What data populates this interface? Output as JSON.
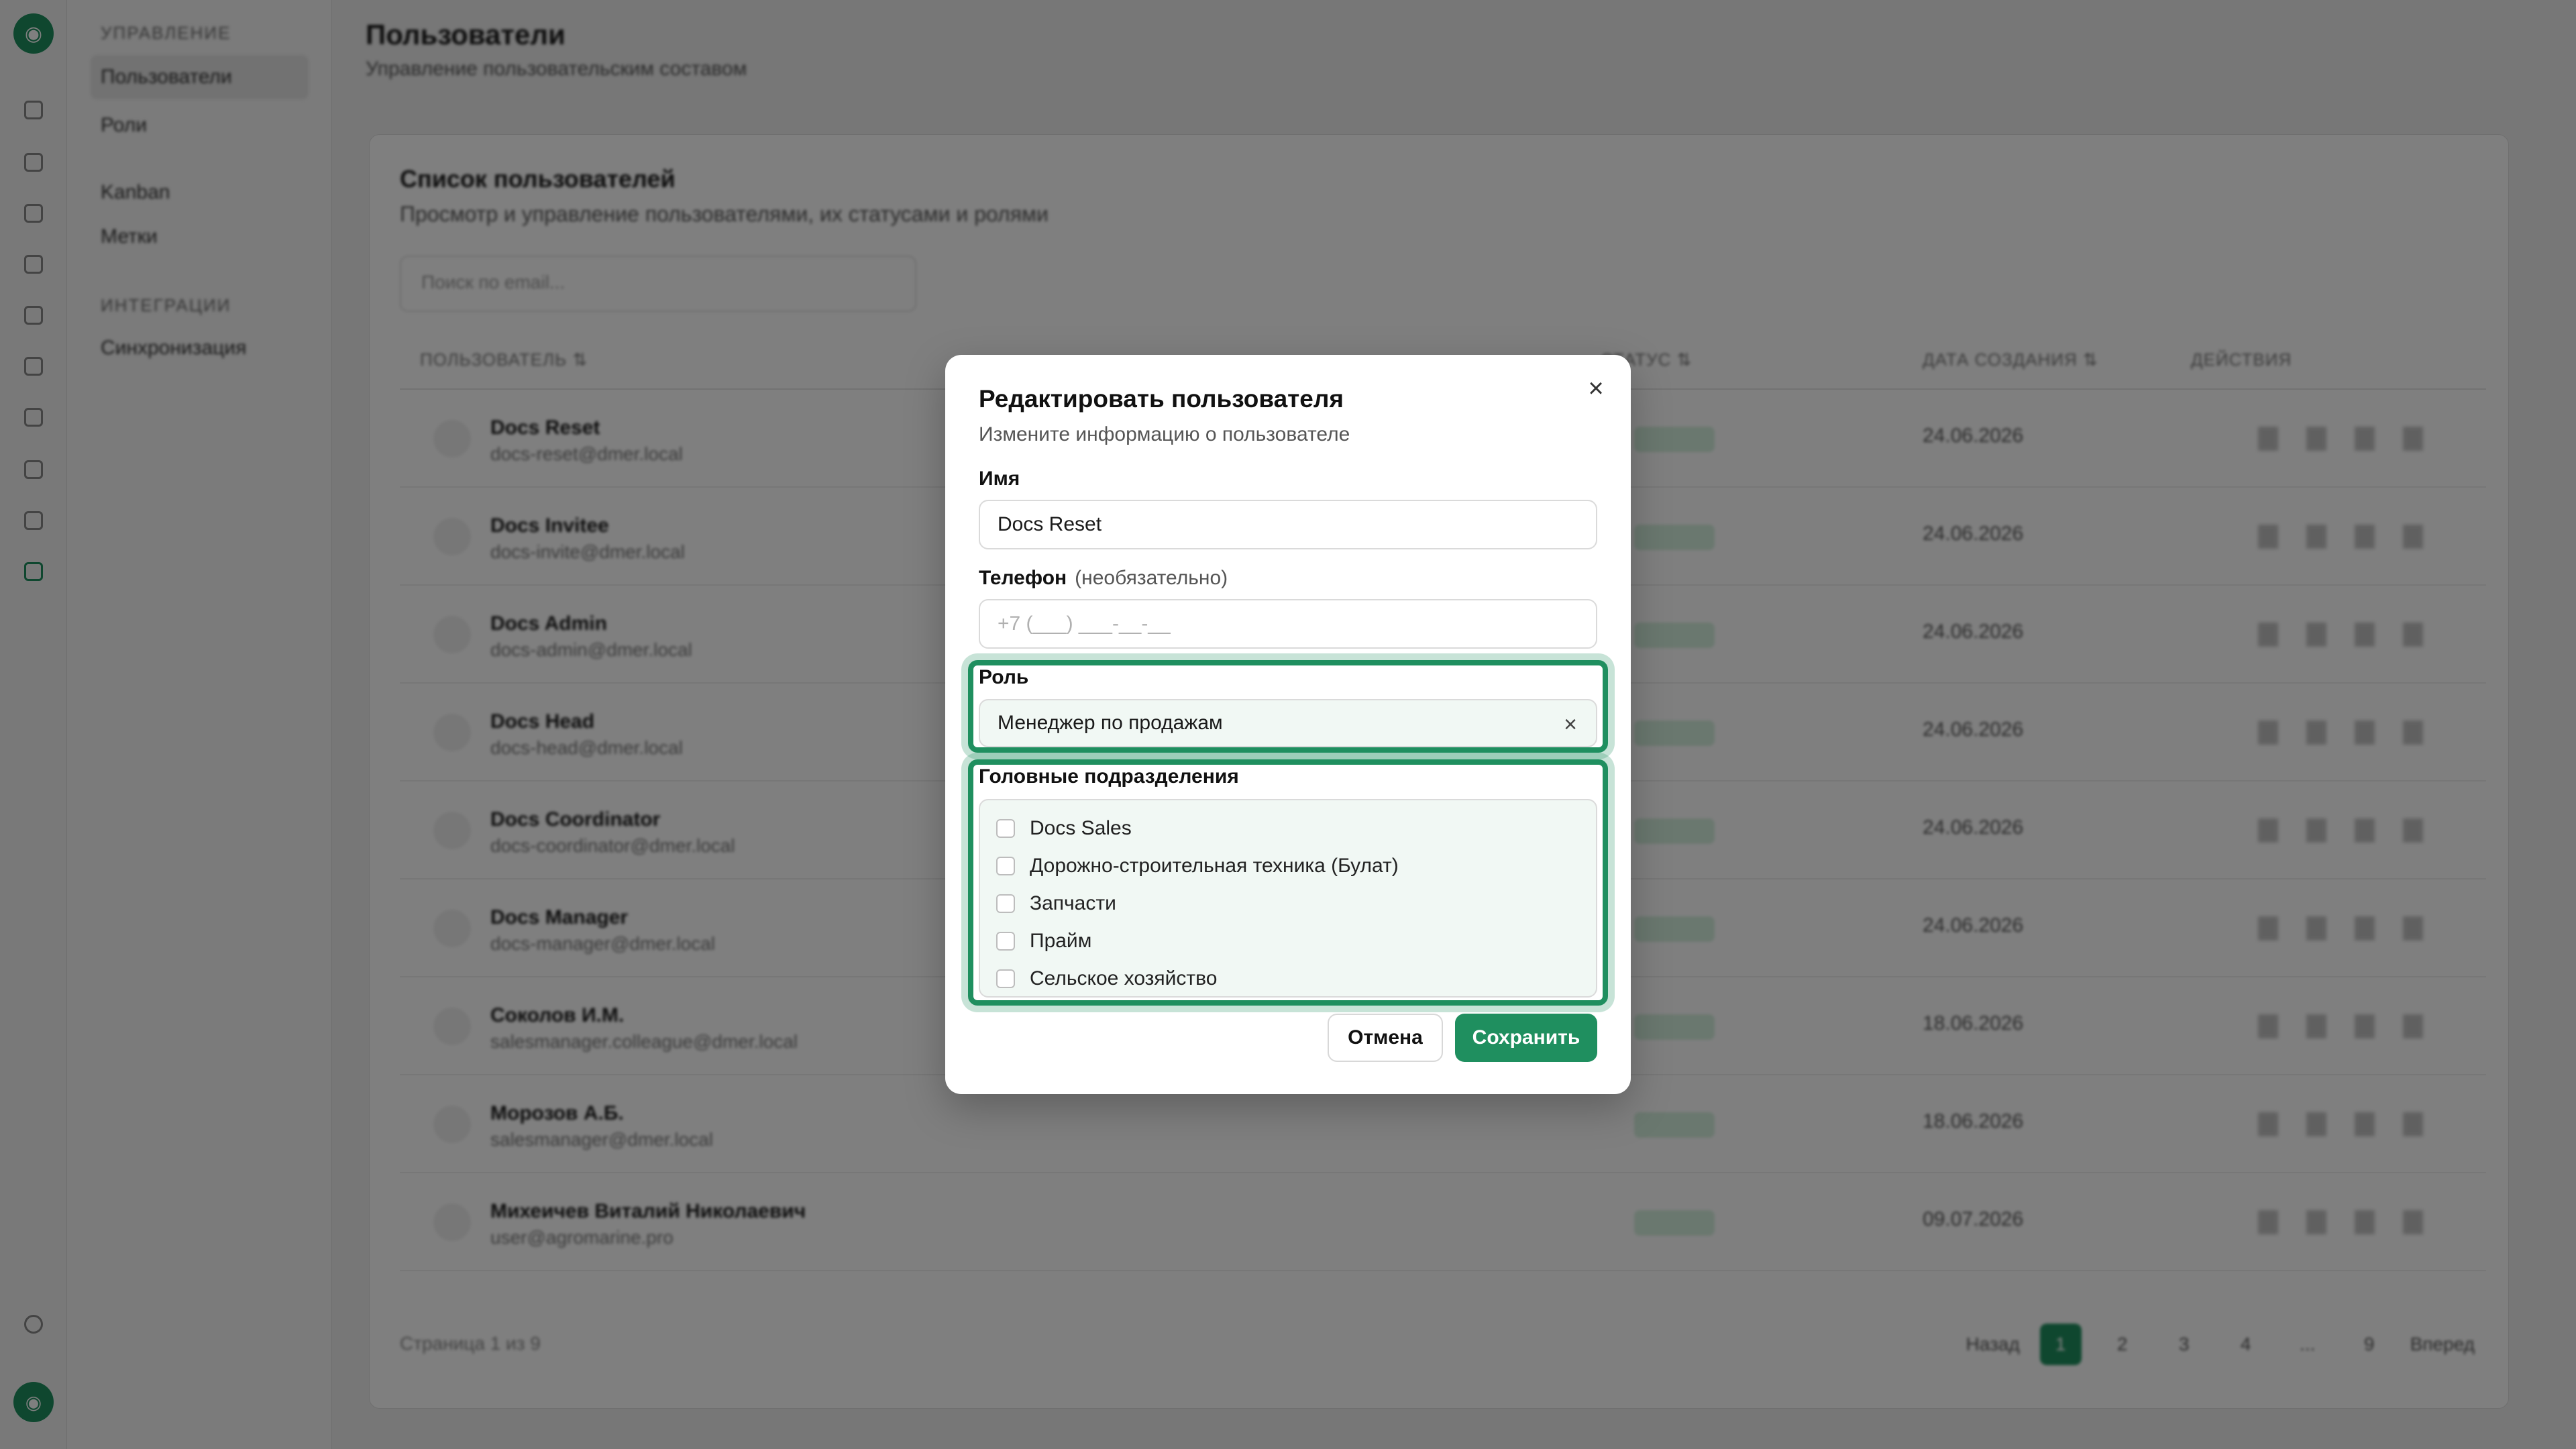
{
  "background": {
    "sidebar": {
      "section1": "УПРАВЛЕНИЕ",
      "item_users": "Пользователи",
      "item_roles": "Роли",
      "item_kanban": "Kanban",
      "item_labels": "Метки",
      "section2": "ИНТЕГРАЦИИ",
      "item_sync": "Синхронизация"
    },
    "page": {
      "title": "Пользователи",
      "subtitle": "Управление пользовательским составом"
    },
    "card": {
      "title": "Список пользователей",
      "subtitle": "Просмотр и управление пользователями, их статусами и ролями",
      "search_placeholder": "Поиск по email...",
      "col_user": "ПОЛЬЗОВАТЕЛЬ ⇅",
      "col_status": "СТАТУС ⇅",
      "col_date": "ДАТА СОЗДАНИЯ ⇅",
      "col_actions": "ДЕЙСТВИЯ",
      "footer": "Страница 1 из 9",
      "pager": [
        "Назад",
        "1",
        "2",
        "3",
        "4",
        "...",
        "9",
        "Вперед"
      ]
    },
    "rows": [
      {
        "name": "Docs Reset",
        "email": "docs-reset@dmer.local",
        "date": "24.06.2026"
      },
      {
        "name": "Docs Invitee",
        "email": "docs-invite@dmer.local",
        "date": "24.06.2026"
      },
      {
        "name": "Docs Admin",
        "email": "docs-admin@dmer.local",
        "date": "24.06.2026"
      },
      {
        "name": "Docs Head",
        "email": "docs-head@dmer.local",
        "date": "24.06.2026"
      },
      {
        "name": "Docs Coordinator",
        "email": "docs-coordinator@dmer.local",
        "date": "24.06.2026"
      },
      {
        "name": "Docs Manager",
        "email": "docs-manager@dmer.local",
        "date": "24.06.2026"
      },
      {
        "name": "Соколов И.М.",
        "email": "salesmanager.colleague@dmer.local",
        "date": "18.06.2026"
      },
      {
        "name": "Морозов А.Б.",
        "email": "salesmanager@dmer.local",
        "date": "18.06.2026"
      },
      {
        "name": "Михеичев Виталий Николаевич",
        "email": "user@agromarine.pro",
        "date": "09.07.2026"
      }
    ]
  },
  "modal": {
    "title": "Редактировать пользователя",
    "subtitle": "Измените информацию о пользователе",
    "name_label": "Имя",
    "name_value": "Docs Reset",
    "phone_label": "Телефон",
    "phone_optional": "(необязательно)",
    "phone_placeholder": "+7 (___) ___-__-__",
    "role_label": "Роль",
    "role_value": "Менеджер по продажам",
    "divisions_label": "Головные подразделения",
    "divisions": [
      "Docs Sales",
      "Дорожно-строительная техника (Булат)",
      "Запчасти",
      "Прайм",
      "Сельское хозяйство"
    ],
    "cancel_label": "Отмена",
    "save_label": "Сохранить",
    "close_glyph": "×",
    "clear_glyph": "×"
  },
  "colors": {
    "accent": "#1f8f5f",
    "overlay": "rgba(0,0,0,0.5)"
  }
}
